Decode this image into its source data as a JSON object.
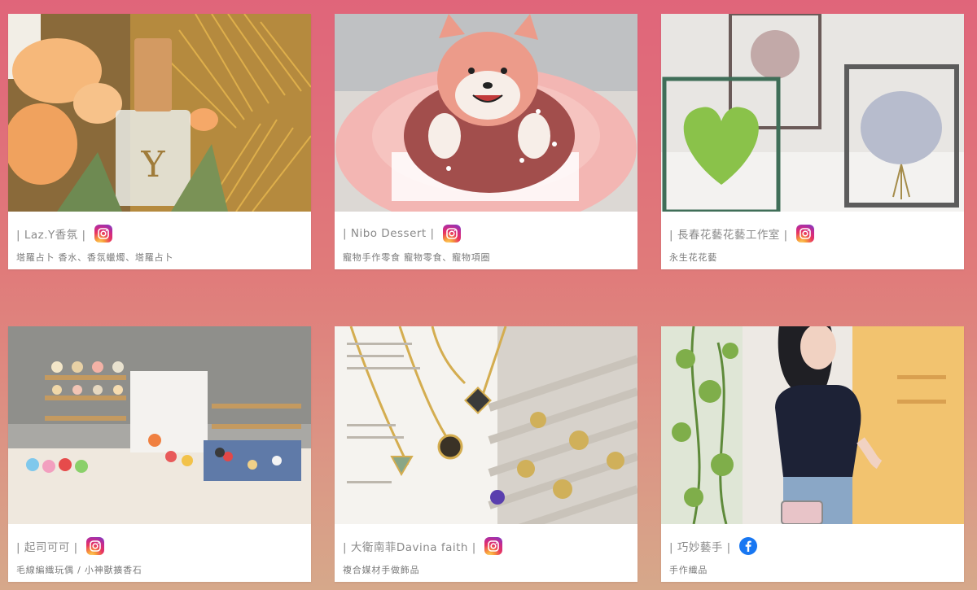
{
  "cards": [
    {
      "title": "| Laz.Y香氛 |",
      "subtitle": "塔羅占卜 香水、香氛蠟燭、塔羅占卜",
      "social": "instagram-icon"
    },
    {
      "title": "| Nibo Dessert |",
      "subtitle": "寵物手作零食 寵物零食、寵物項圈",
      "social": "instagram-icon"
    },
    {
      "title": "| 長春花藝花藝工作室 |",
      "subtitle": "永生花花藝",
      "social": "instagram-icon"
    },
    {
      "title": "| 起司可可 |",
      "subtitle": "毛線編織玩偶 / 小神獸擴香石",
      "social": "instagram-icon"
    },
    {
      "title": "| 大衛南菲Davina faith |",
      "subtitle": "複合媒材手做飾品",
      "social": "instagram-icon"
    },
    {
      "title": "| 巧妙藝手 |",
      "subtitle": "手作織品",
      "social": "facebook-icon"
    }
  ],
  "colors": {
    "background_top": "#e0657a",
    "background_bottom": "#d6a88a",
    "instagram": "#e8345f",
    "facebook": "#1877f2"
  }
}
